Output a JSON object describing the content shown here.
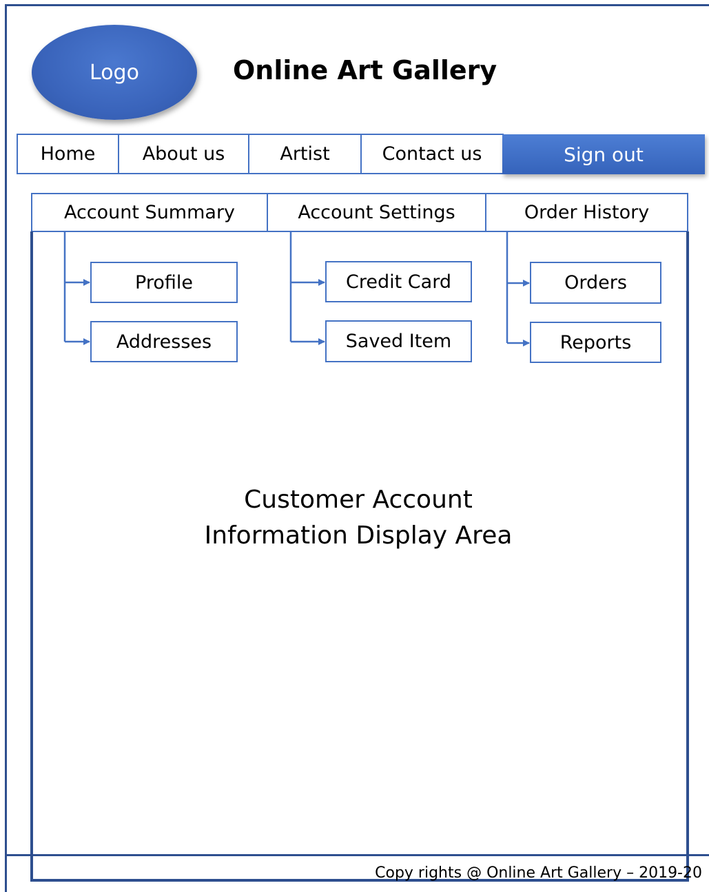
{
  "header": {
    "logo_label": "Logo",
    "site_title": "Online Art Gallery"
  },
  "nav": {
    "items": [
      "Home",
      "About us",
      "Artist",
      "Contact us"
    ],
    "signout_label": "Sign out"
  },
  "tabs": [
    {
      "label": "Account Summary",
      "children": [
        "Profile",
        "Addresses"
      ]
    },
    {
      "label": "Account Settings",
      "children": [
        "Credit Card",
        "Saved Item"
      ]
    },
    {
      "label": "Order History",
      "children": [
        "Orders",
        "Reports"
      ]
    }
  ],
  "content": {
    "display_line1": "Customer Account",
    "display_line2": "Information Display Area"
  },
  "footer": {
    "copyright": "Copy rights @ Online Art Gallery – 2019-20"
  },
  "colors": {
    "frame": "#2e4f8f",
    "accent": "#4472c4",
    "button": "#3a68c0"
  }
}
